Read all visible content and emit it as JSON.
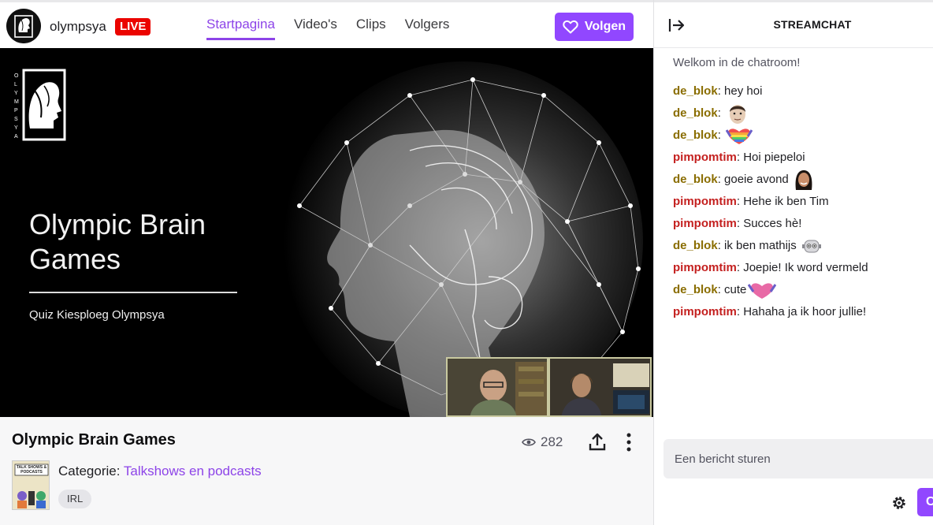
{
  "channel": {
    "name": "olympsya",
    "live_label": "LIVE"
  },
  "nav": [
    {
      "label": "Startpagina",
      "active": true
    },
    {
      "label": "Video's",
      "active": false
    },
    {
      "label": "Clips",
      "active": false
    },
    {
      "label": "Volgers",
      "active": false
    }
  ],
  "follow_label": "Volgen",
  "video": {
    "logo_text": "OLYMPSYA",
    "slide_title": "Olympic Brain Games",
    "slide_subtitle": "Quiz Kiesploeg Olympsya"
  },
  "stream": {
    "title": "Olympic Brain Games",
    "viewers": "282",
    "category_label": "Categorie:",
    "category": "Talkshows en podcasts",
    "category_thumb_text": "TALK SHOWS & PODCASTS",
    "tag": "IRL"
  },
  "chat": {
    "title": "STREAMCHAT",
    "welcome": "Welkom in de chatroom!",
    "messages": [
      {
        "user": "de_blok",
        "text": "hey hoi",
        "emote": ""
      },
      {
        "user": "de_blok",
        "text": "",
        "emote": "face-emote"
      },
      {
        "user": "de_blok",
        "text": "",
        "emote": "rainbow-heart-emote"
      },
      {
        "user": "pimpomtim",
        "text": "Hoi piepeloi",
        "emote": ""
      },
      {
        "user": "de_blok",
        "text": "goeie avond",
        "emote": "woman-emote"
      },
      {
        "user": "pimpomtim",
        "text": "Hehe ik ben Tim",
        "emote": ""
      },
      {
        "user": "pimpomtim",
        "text": "Succes hè!",
        "emote": ""
      },
      {
        "user": "de_blok",
        "text": "ik ben mathijs",
        "emote": "robot-emote"
      },
      {
        "user": "pimpomtim",
        "text": "Joepie! Ik word vermeld",
        "emote": ""
      },
      {
        "user": "de_blok",
        "text": "cute",
        "emote": "pink-heart-emote"
      },
      {
        "user": "pimpomtim",
        "text": "Hahaha ja ik hoor jullie!",
        "emote": ""
      }
    ],
    "input_placeholder": "Een bericht sturen",
    "send_label": "Chatten"
  },
  "colors": {
    "accent": "#9147ff",
    "live": "#eb0400",
    "user_de_blok": "#8a6d00",
    "user_pimpomtim": "#c4201f"
  }
}
